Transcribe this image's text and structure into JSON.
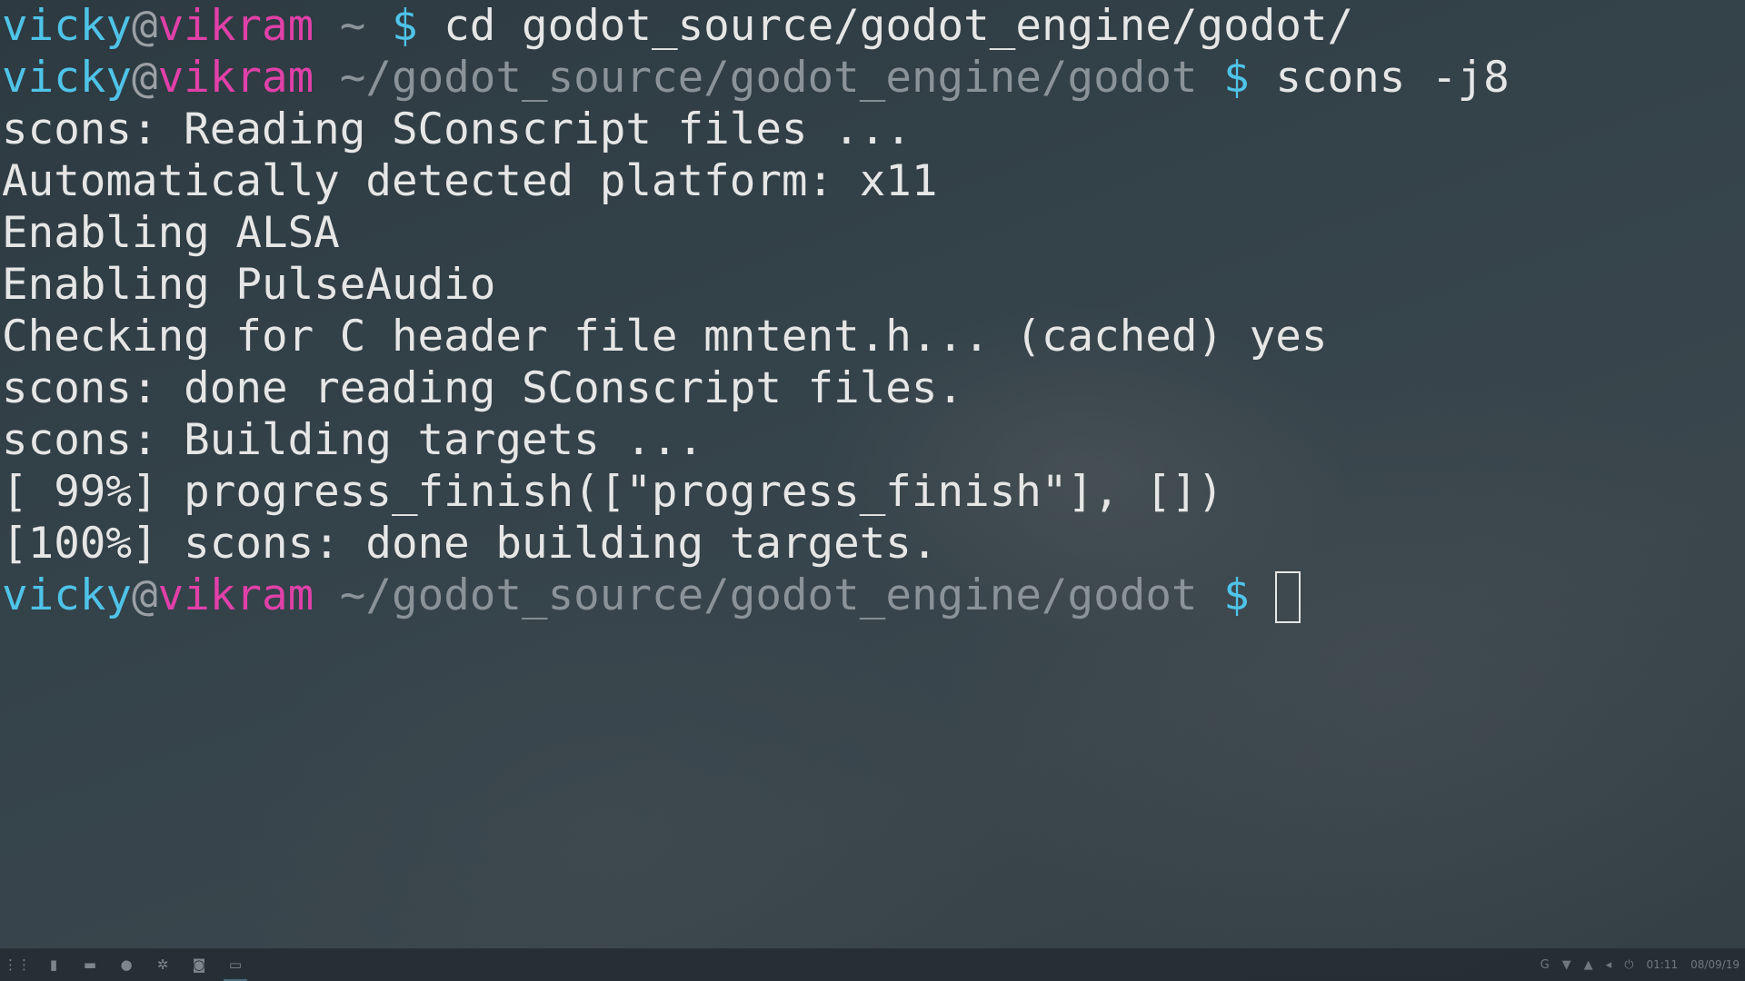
{
  "terminal": {
    "line1": {
      "user": "vicky",
      "at": "@",
      "host": "vikram",
      "path": " ~ ",
      "prompt": "$",
      "command": " cd godot_source/godot_engine/godot/"
    },
    "line2": {
      "user": "vicky",
      "at": "@",
      "host": "vikram",
      "path": " ~/godot_source/godot_engine/godot ",
      "prompt": "$",
      "command": " scons -j8"
    },
    "output": [
      "scons: Reading SConscript files ...",
      "Automatically detected platform: x11",
      "Enabling ALSA",
      "Enabling PulseAudio",
      "Checking for C header file mntent.h... (cached) yes",
      "scons: done reading SConscript files.",
      "scons: Building targets ...",
      "[ 99%] progress_finish([\"progress_finish\"], [])",
      "[100%] scons: done building targets."
    ],
    "line_final": {
      "user": "vicky",
      "at": "@",
      "host": "vikram",
      "path": " ~/godot_source/godot_engine/godot ",
      "prompt": "$",
      "command": " "
    }
  },
  "colors": {
    "user": "#4fc3e8",
    "host": "#e040a8",
    "path": "#8a9398",
    "text": "#e6e6e6",
    "background": "#34424a"
  },
  "taskbar": {
    "apps": [
      {
        "icon": "app-grid-icon",
        "glyph": "⋮⋮"
      },
      {
        "icon": "info-icon",
        "glyph": "▮"
      },
      {
        "icon": "file-manager-icon",
        "glyph": "▬"
      },
      {
        "icon": "firefox-icon",
        "glyph": "●"
      },
      {
        "icon": "settings-icon",
        "glyph": "✲"
      },
      {
        "icon": "media-icon",
        "glyph": "◙"
      },
      {
        "icon": "terminal-icon",
        "glyph": "▭"
      }
    ],
    "tray": {
      "app_icon": "G",
      "wifi": "▼",
      "notification": "▲",
      "volume": "◂",
      "power": "⏻",
      "time": "01:11",
      "date": "08/09/19"
    }
  }
}
